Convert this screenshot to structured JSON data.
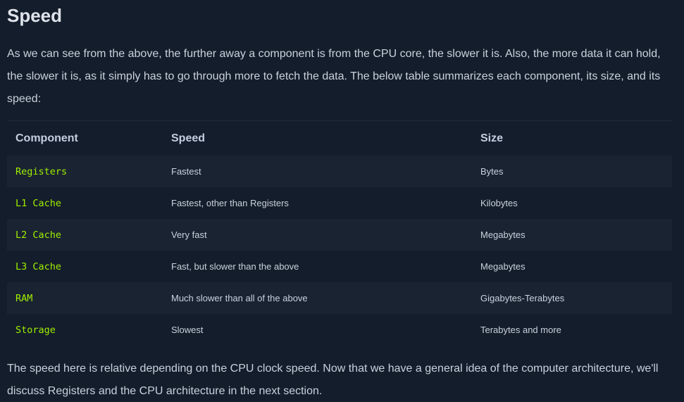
{
  "heading": "Speed",
  "intro": "As we can see from the above, the further away a component is from the CPU core, the slower it is. Also, the more data it can hold, the slower it is, as it simply has to go through more to fetch the data. The below table summarizes each component, its size, and its speed:",
  "table": {
    "headers": [
      "Component",
      "Speed",
      "Size"
    ],
    "rows": [
      {
        "component": "Registers",
        "speed": "Fastest",
        "size": "Bytes"
      },
      {
        "component": "L1 Cache",
        "speed": "Fastest, other than Registers",
        "size": "Kilobytes"
      },
      {
        "component": "L2 Cache",
        "speed": "Very fast",
        "size": "Megabytes"
      },
      {
        "component": "L3 Cache",
        "speed": "Fast, but slower than the above",
        "size": "Megabytes"
      },
      {
        "component": "RAM",
        "speed": "Much slower than all of the above",
        "size": "Gigabytes-Terabytes"
      },
      {
        "component": "Storage",
        "speed": "Slowest",
        "size": "Terabytes and more"
      }
    ]
  },
  "outro": "The speed here is relative depending on the CPU clock speed. Now that we have a general idea of the computer architecture, we'll discuss Registers and the CPU architecture in the next section.",
  "colors": {
    "background": "#141d2b",
    "row_alt": "#1a2332",
    "code_green": "#9fef00",
    "text": "#c9d1dd"
  }
}
